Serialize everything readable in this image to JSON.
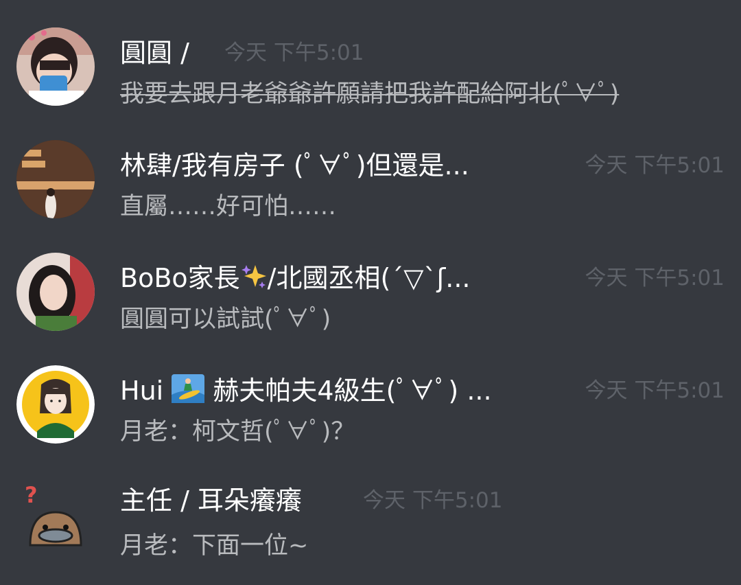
{
  "messages": [
    {
      "author": "圓圓 /",
      "time": "今天 下午5:01",
      "text": "我要去跟月老爺爺許願請把我許配給阿北(ﾟ∀ﾟ)",
      "strikethrough": true,
      "avatar": "photo-girl-with-phone"
    },
    {
      "author": "林肆/我有房子 (ﾟ∀ﾟ)但還是...",
      "time": "今天 下午5:01",
      "text": "直屬……好可怕……",
      "avatar": "photo-terminator-wall"
    },
    {
      "author_prefix": "BoBo家長",
      "author_emoji": "sparkles-icon",
      "author_suffix": "/北國丞相(´▽`ʃ...",
      "time": "今天 下午5:01",
      "text": "圓圓可以試試(ﾟ∀ﾟ)",
      "avatar": "photo-woman-portrait"
    },
    {
      "author_prefix": "Hui",
      "author_emoji": "surfer-icon",
      "author_suffix": "赫夫帕夫4級生(ﾟ∀ﾟ) ...",
      "time": "今天 下午5:01",
      "text": "月老：柯文哲(ﾟ∀ﾟ)？",
      "avatar": "cartoon-girl-yellow"
    },
    {
      "author": "主任 / 耳朵癢癢",
      "time": "今天 下午5:01",
      "text": "月老：下面一位~",
      "avatar": "cartoon-platypus-question"
    }
  ],
  "colors": {
    "background": "#36393f",
    "author": "#ffffff",
    "body": "#b9bbbe",
    "timestamp": "#5e6269"
  }
}
